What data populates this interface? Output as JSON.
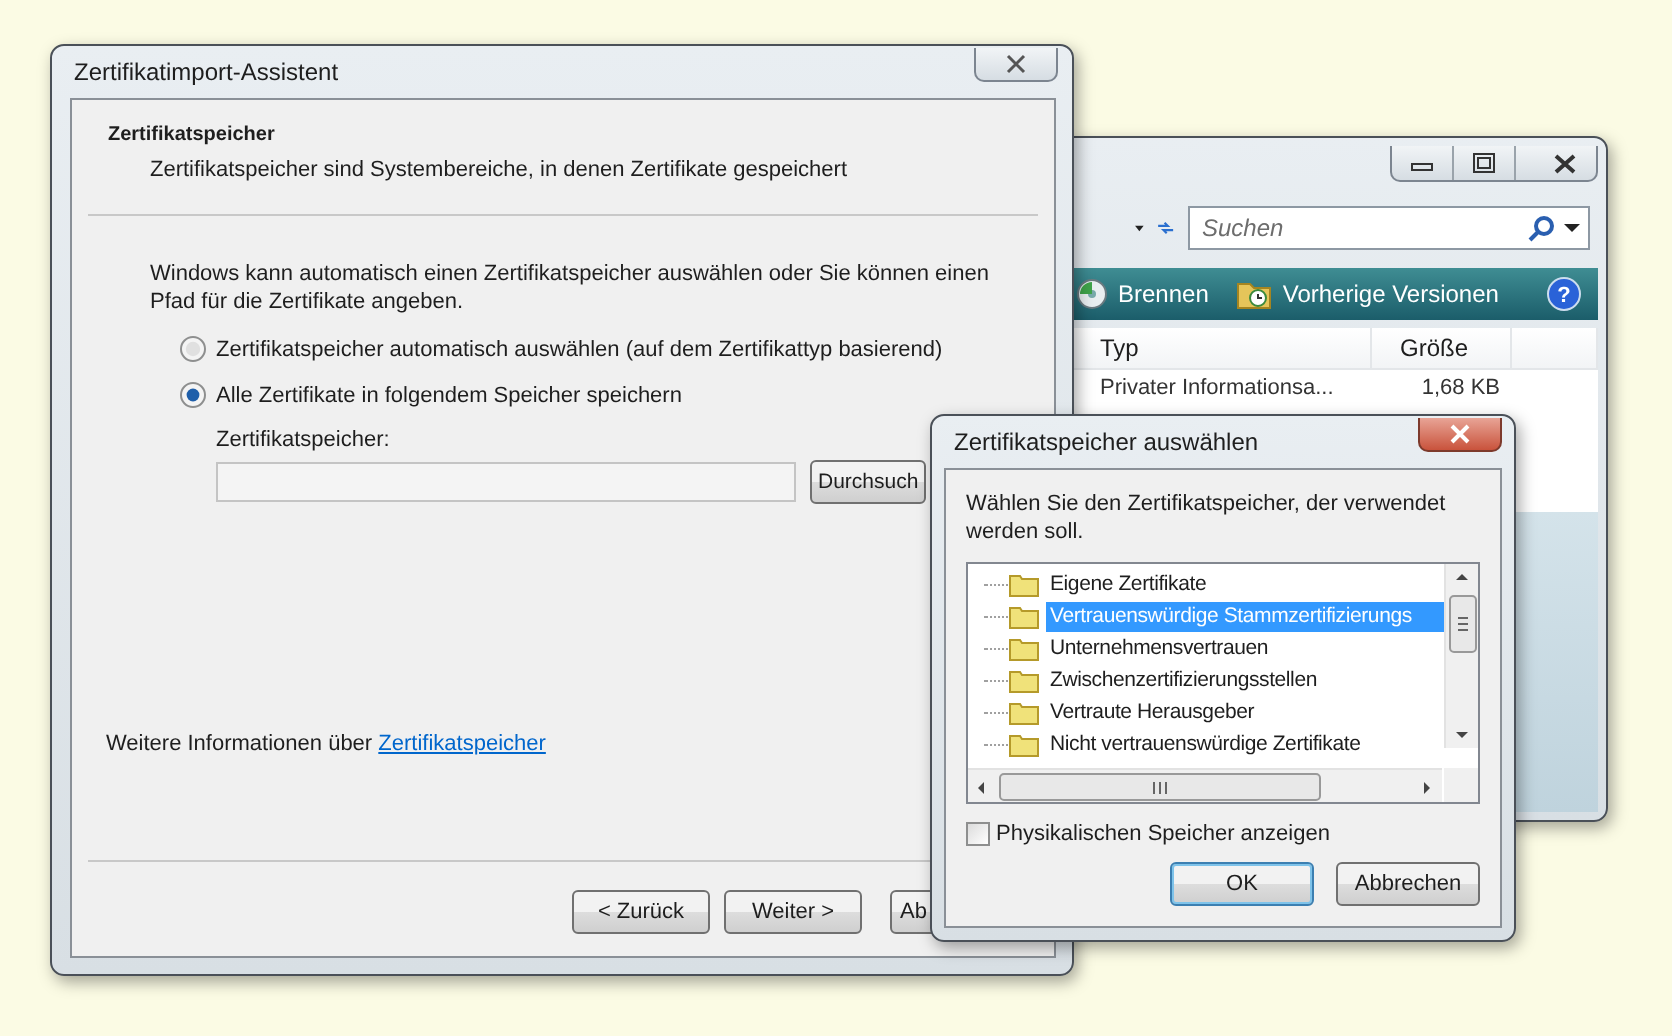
{
  "explorer": {
    "search": {
      "placeholder": "Suchen"
    },
    "commands": [
      {
        "label": "Brennen",
        "kind": "burn"
      },
      {
        "label": "Vorherige Versionen",
        "kind": "versions"
      }
    ],
    "help": "?",
    "columns": [
      "Typ",
      "Größe"
    ],
    "rows": [
      [
        "Privater Informationsa...",
        "1,68 KB"
      ]
    ]
  },
  "wizard": {
    "title": "Zertifikatimport-Assistent",
    "header_title": "Zertifikatspeicher",
    "header_subtitle": "Zertifikatspeicher sind Systembereiche, in denen Zertifikate gespeichert",
    "intro": "Windows kann automatisch einen Zertifikatspeicher auswählen oder Sie können einen Pfad für die Zertifikate angeben.",
    "options": [
      {
        "label": "Zertifikatspeicher automatisch auswählen (auf dem Zertifikattyp basierend)",
        "selected": false
      },
      {
        "label": "Alle Zertifikate in folgendem Speicher speichern",
        "selected": true
      }
    ],
    "store_label": "Zertifikatspeicher:",
    "browse_button": "Durchsuch",
    "info_text": "Weitere Informationen über",
    "info_link": "Zertifikatspeicher",
    "buttons": [
      "< Zurück",
      "Weiter >",
      "Ab"
    ]
  },
  "dialog": {
    "title": "Zertifikatspeicher auswählen",
    "prompt": "Wählen Sie den Zertifikatspeicher, der verwendet werden soll.",
    "stores": [
      {
        "label": "Eigene Zertifikate",
        "selected": false
      },
      {
        "label": "Vertrauenswürdige Stammzertifizierungs",
        "selected": true
      },
      {
        "label": "Unternehmensvertrauen",
        "selected": false
      },
      {
        "label": "Zwischenzertifizierungsstellen",
        "selected": false
      },
      {
        "label": "Vertraute Herausgeber",
        "selected": false
      },
      {
        "label": "Nicht vertrauenswürdige Zertifikate",
        "selected": false
      }
    ],
    "show_physical": {
      "label": "Physikalischen Speicher anzeigen",
      "checked": false
    },
    "buttons": [
      {
        "label": "OK",
        "default": true
      },
      {
        "label": "Abbrechen",
        "default": false
      }
    ]
  }
}
